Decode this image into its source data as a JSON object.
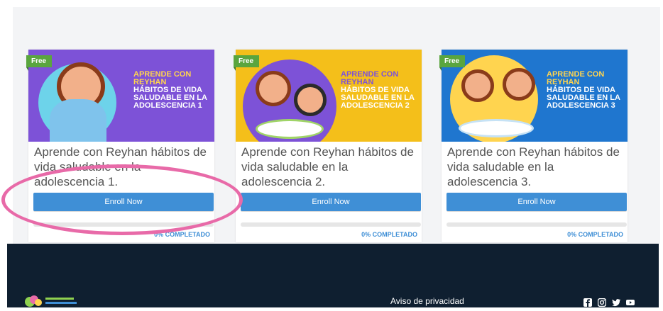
{
  "courses": [
    {
      "badge": "Free",
      "thumb_line1": "APRENDE CON REYHAN",
      "thumb_line2": "HÁBITOS DE VIDA SALUDABLE EN LA ADOLESCENCIA 1",
      "title": "Aprende con Reyhan hábitos de vida saludable en la adolescencia 1.",
      "enroll_label": "Enroll Now",
      "progress_label": "0% COMPLETADO",
      "progress": 0,
      "bg_color": "#7d52d7",
      "accent_color": "#ffd44f"
    },
    {
      "badge": "Free",
      "thumb_line1": "APRENDE CON REYHAN",
      "thumb_line2": "HÁBITOS DE VIDA SALUDABLE EN LA ADOLESCENCIA 2",
      "title": "Aprende con Reyhan hábitos de vida saludable en la adolescencia 2.",
      "enroll_label": "Enroll Now",
      "progress_label": "0% COMPLETADO",
      "progress": 0,
      "bg_color": "#f4bf1a",
      "accent_color": "#7d52d7"
    },
    {
      "badge": "Free",
      "thumb_line1": "APRENDE CON REYHAN",
      "thumb_line2": "HÁBITOS DE VIDA SALUDABLE EN LA ADOLESCENCIA 3",
      "title": "Aprende con Reyhan hábitos de vida saludable en la adolescencia 3.",
      "enroll_label": "Enroll Now",
      "progress_label": "0% COMPLETADO",
      "progress": 0,
      "bg_color": "#1f76cf",
      "accent_color": "#ffd44f"
    }
  ],
  "footer": {
    "privacy_link": "Aviso de privacidad",
    "social_icons": [
      "facebook-icon",
      "instagram-icon",
      "twitter-icon",
      "youtube-icon"
    ]
  },
  "colors": {
    "primary_button": "#3f8fd6",
    "footer_bg": "#0f1f30",
    "free_badge": "#5aa53e",
    "annotation": "#e86aa8"
  }
}
